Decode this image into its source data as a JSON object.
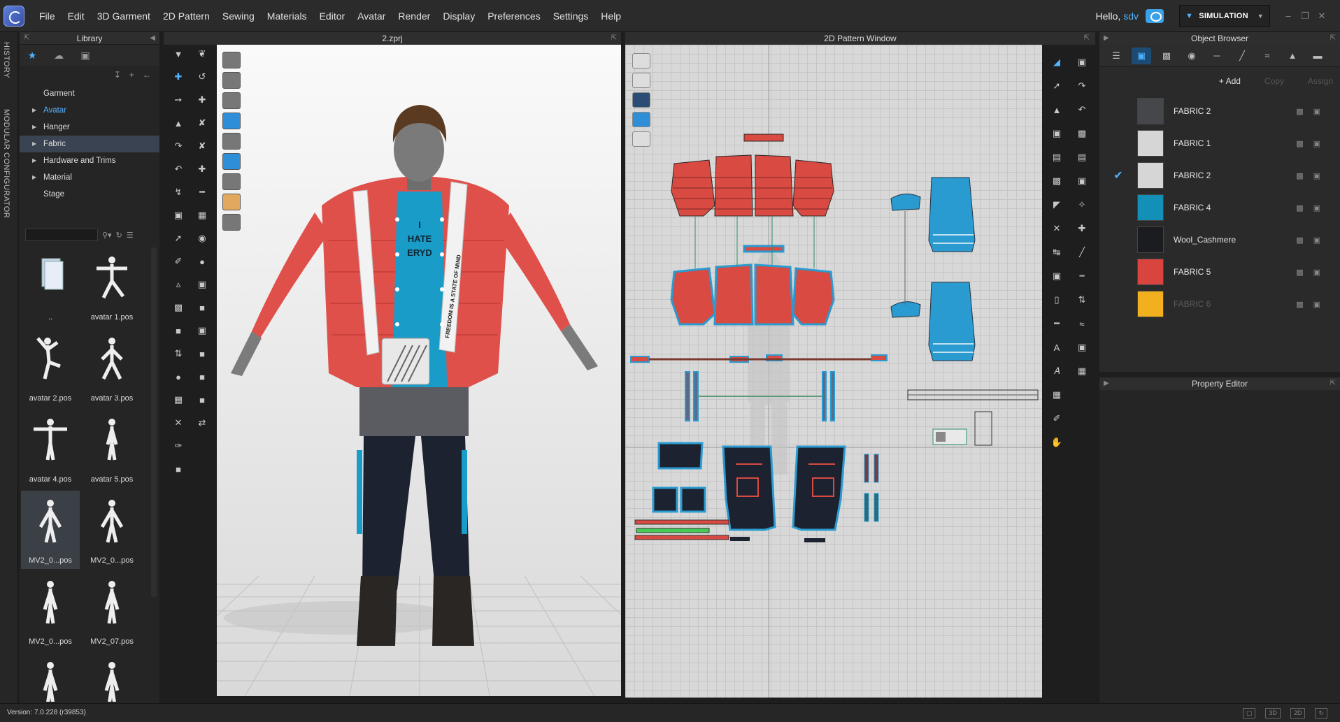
{
  "menubar": {
    "items": [
      "File",
      "Edit",
      "3D Garment",
      "2D Pattern",
      "Sewing",
      "Materials",
      "Editor",
      "Avatar",
      "Render",
      "Display",
      "Preferences",
      "Settings",
      "Help"
    ],
    "greeting": "Hello,",
    "username": "sdv",
    "mode": "SIMULATION"
  },
  "side_tabs": {
    "history": "HISTORY",
    "modular": "MODULAR CONFIGURATOR"
  },
  "library": {
    "title": "Library",
    "tree": [
      {
        "label": "Garment",
        "expandable": false,
        "highlight": false,
        "selected": false
      },
      {
        "label": "Avatar",
        "expandable": true,
        "highlight": true,
        "selected": false
      },
      {
        "label": "Hanger",
        "expandable": true,
        "highlight": false,
        "selected": false
      },
      {
        "label": "Fabric",
        "expandable": true,
        "highlight": false,
        "selected": true
      },
      {
        "label": "Hardware and Trims",
        "expandable": true,
        "highlight": false,
        "selected": false
      },
      {
        "label": "Material",
        "expandable": true,
        "highlight": false,
        "selected": false
      },
      {
        "label": "Stage",
        "expandable": false,
        "highlight": false,
        "selected": false
      }
    ],
    "thumbnails": [
      {
        "label": "..",
        "kind": "folder"
      },
      {
        "label": "avatar 1.pos",
        "kind": "pose-a"
      },
      {
        "label": "avatar 2.pos",
        "kind": "pose-b"
      },
      {
        "label": "avatar 3.pos",
        "kind": "pose-c"
      },
      {
        "label": "avatar 4.pos",
        "kind": "pose-d"
      },
      {
        "label": "avatar 5.pos",
        "kind": "pose-e"
      },
      {
        "label": "MV2_0...pos",
        "kind": "pose-t",
        "selected": true
      },
      {
        "label": "MV2_0...pos",
        "kind": "pose-t"
      },
      {
        "label": "MV2_0...pos",
        "kind": "pose-s"
      },
      {
        "label": "MV2_07.pos",
        "kind": "pose-s"
      },
      {
        "label": "",
        "kind": "pose-s"
      },
      {
        "label": "",
        "kind": "pose-s"
      }
    ]
  },
  "view3d": {
    "title": "2.zprj",
    "shirt_text": [
      "I",
      "HATE",
      "ERYD"
    ],
    "strap_text": "FREEDOM IS A STATE OF MIND"
  },
  "view2d": {
    "title": "2D Pattern Window"
  },
  "object_browser": {
    "title": "Object Browser",
    "actions": [
      {
        "label": "+ Add",
        "enabled": true
      },
      {
        "label": "Copy",
        "enabled": false
      },
      {
        "label": "Assign",
        "enabled": false
      }
    ],
    "fabrics": [
      {
        "name": "FABRIC 2",
        "color": "#45474b",
        "checked": false,
        "dim": false
      },
      {
        "name": "FABRIC 1",
        "color": "#d6d6d6",
        "checked": false,
        "dim": false
      },
      {
        "name": "FABRIC 2",
        "color": "#d6d6d6",
        "checked": true,
        "dim": false
      },
      {
        "name": "FABRIC 4",
        "color": "#1390b8",
        "checked": false,
        "dim": false
      },
      {
        "name": "Wool_Cashmere",
        "color": "#1b1c20",
        "checked": false,
        "dim": false
      },
      {
        "name": "FABRIC 5",
        "color": "#d9453e",
        "checked": false,
        "dim": false
      },
      {
        "name": "FABRIC 6",
        "color": "#f2b01e",
        "checked": false,
        "dim": true
      }
    ]
  },
  "property_editor": {
    "title": "Property Editor"
  },
  "status": {
    "version": "Version: 7.0.228 (r39853)"
  },
  "colors": {
    "accent": "#4fb3ff",
    "jacket": "#e0504a",
    "shirt": "#1a9cc8",
    "pattern_red": "#d84a42",
    "pattern_blue": "#2a9bd0"
  }
}
